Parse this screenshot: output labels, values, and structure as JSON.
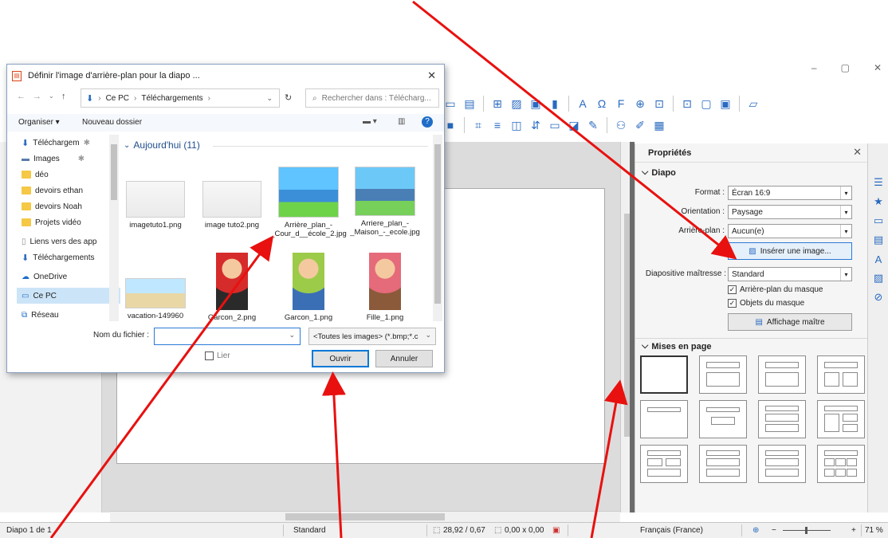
{
  "window": {
    "minimize": "–",
    "maximize": "▢",
    "close": "✕"
  },
  "dialog": {
    "title": "Définir l'image d'arrière-plan pour la diapo ...",
    "close": "✕",
    "breadcrumb": [
      "Ce PC",
      "Téléchargements"
    ],
    "search_placeholder": "Rechercher dans : Télécharg...",
    "organize": "Organiser ▾",
    "new_folder": "Nouveau dossier",
    "nav_items": [
      {
        "label": "Téléchargem",
        "icon": "download-arrow-icon"
      },
      {
        "label": "Images",
        "icon": "images-icon"
      },
      {
        "label": "déo",
        "icon": "folder-icon"
      },
      {
        "label": "devoirs ethan",
        "icon": "folder-icon"
      },
      {
        "label": "devoirs Noah",
        "icon": "folder-icon"
      },
      {
        "label": "Projets vidéo",
        "icon": "folder-icon"
      },
      {
        "label": "Liens vers des app",
        "icon": "file-icon"
      },
      {
        "label": "Téléchargements",
        "icon": "download-arrow-icon"
      },
      {
        "label": "OneDrive",
        "icon": "cloud-icon"
      },
      {
        "label": "Ce PC",
        "icon": "pc-icon"
      },
      {
        "label": "Réseau",
        "icon": "network-icon"
      }
    ],
    "group_header": "Aujourd'hui (11)",
    "files": [
      {
        "name": "imagetuto1.png"
      },
      {
        "name": "image tuto2.png"
      },
      {
        "name": "Arrière_plan_-_Cour_d__école_2.jpg"
      },
      {
        "name": "Arriere_plan_-_Maison_-_ecole.jpg"
      },
      {
        "name": "vacation-149960"
      },
      {
        "name": "Garcon_2.png"
      },
      {
        "name": "Garcon_1.png"
      },
      {
        "name": "Fille_1.png"
      }
    ],
    "filename_label": "Nom du fichier :",
    "filename_value": "",
    "filter": "<Toutes les images> (*.bmp;*.c",
    "link_label": "Lier",
    "open_button": "Ouvrir",
    "cancel_button": "Annuler"
  },
  "sidebar": {
    "title": "Propriétés",
    "close": "✕",
    "slide_section": "Diapo",
    "format_label": "Format :",
    "format_value": "Écran 16:9",
    "orientation_label": "Orientation :",
    "orientation_value": "Paysage",
    "background_label": "Arrière-plan :",
    "background_value": "Aucun(e)",
    "insert_image_button": "Insérer une image...",
    "master_label": "Diapositive maîtresse :",
    "master_value": "Standard",
    "master_bg_check": "Arrière-plan du masque",
    "master_objects_check": "Objets du masque",
    "master_view_button": "Affichage maître",
    "layouts_section": "Mises en page"
  },
  "statusbar": {
    "slide": "Diapo 1 de 1",
    "master": "Standard",
    "position": "28,92 / 0,67",
    "size": "0,00 x 0,00",
    "language": "Français (France)",
    "zoom": "71 %"
  },
  "colors": {
    "annotation_arrow": "#e8110f",
    "accent": "#2a7ad6"
  }
}
